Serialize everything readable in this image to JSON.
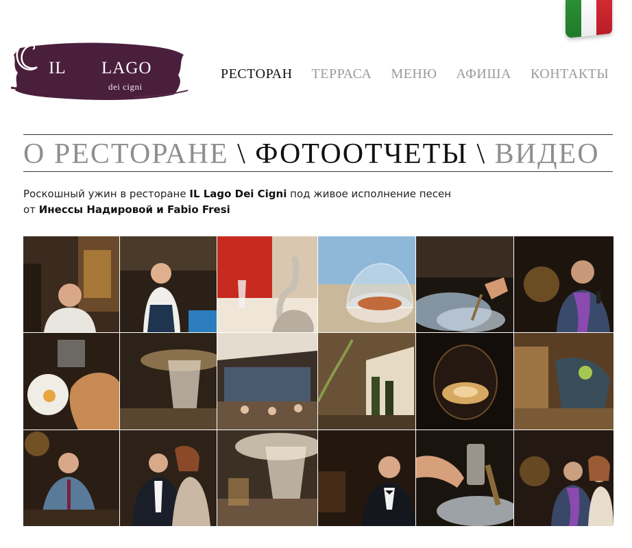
{
  "language": {
    "flag": "italian-flag-icon"
  },
  "logo": {
    "main": "IL",
    "main2": "LAGO",
    "sub": "dei cigni"
  },
  "nav": {
    "items": [
      {
        "label": "РЕСТОРАН",
        "active": true
      },
      {
        "label": "ТЕРРАСА",
        "active": false
      },
      {
        "label": "МЕНЮ",
        "active": false
      },
      {
        "label": "АФИША",
        "active": false
      },
      {
        "label": "КОНТАКТЫ",
        "active": false
      }
    ]
  },
  "heading": {
    "about": "О РЕСТОРАНЕ",
    "sep1": " \\ ",
    "photos": "ФОТООТЧЕТЫ",
    "sep2": " \\ ",
    "video": "ВИДЕО"
  },
  "description": {
    "line1_pre": "Роскошный ужин в ресторане ",
    "line1_bold": "IL Lago Dei Cigni",
    "line1_post": " под живое исполнение песен",
    "line2_pre": "от ",
    "line2_bold": "Инессы Надировой и Fabio Fresi"
  },
  "colors": {
    "logo_brush": "#4a1f3c",
    "nav_active": "#111111",
    "nav_inactive": "#9a9a9a"
  },
  "gallery": {
    "photos": [
      "chef-photo",
      "waiter-photo",
      "swan-decor-photo",
      "dessert-cloche-photo",
      "smoke-dish-photo",
      "singer-photo",
      "plated-dish-photo",
      "chandelier-photo",
      "dining-hall-photo",
      "wine-bottles-photo",
      "nest-dish-photo",
      "bar-decor-photo",
      "bartender-photo",
      "couple-photo",
      "crystal-hall-photo",
      "guest-portrait-photo",
      "pouring-photo",
      "singers-duet-photo"
    ]
  }
}
